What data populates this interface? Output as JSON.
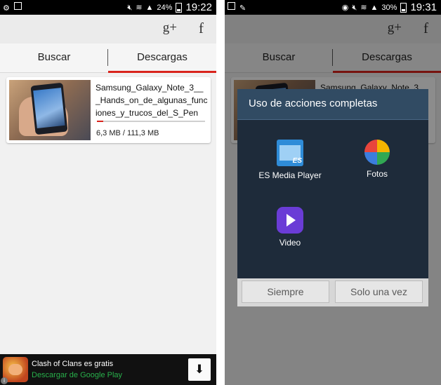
{
  "left": {
    "status": {
      "battery": "24%",
      "time": "19:22"
    },
    "actionbar": {
      "gplus": "g+",
      "facebook": "f"
    },
    "tabs": [
      "Buscar",
      "Descargas"
    ],
    "download": {
      "title": "Samsung_Galaxy_Note_3___Hands_on_de_algunas_funciones_y_trucos_del_S_Pen",
      "size": "6,3 MB / 111,3 MB",
      "progress": 0.057
    },
    "ad": {
      "app_name": "Clash of Clans es gratis",
      "store": "Descargar de Google Play",
      "info": "i"
    }
  },
  "right": {
    "status": {
      "battery": "30%",
      "time": "19:31"
    },
    "actionbar": {
      "gplus": "g+",
      "facebook": "f"
    },
    "tabs": [
      "Buscar",
      "Descargas"
    ],
    "background_title": "Samsung_Galaxy_Note_3__Hands_on_de_algunas_fun",
    "dialog": {
      "title": "Uso de acciones completas",
      "options": [
        "ES Media Player",
        "Fotos",
        "Video"
      ],
      "es_badge": "ES",
      "buttons": [
        "Siempre",
        "Solo una vez"
      ]
    }
  },
  "colors": {
    "accent": "#d9241d",
    "dialog_bg": "#1e2b3a",
    "dialog_header": "#314b63",
    "store_green": "#28b04b"
  }
}
